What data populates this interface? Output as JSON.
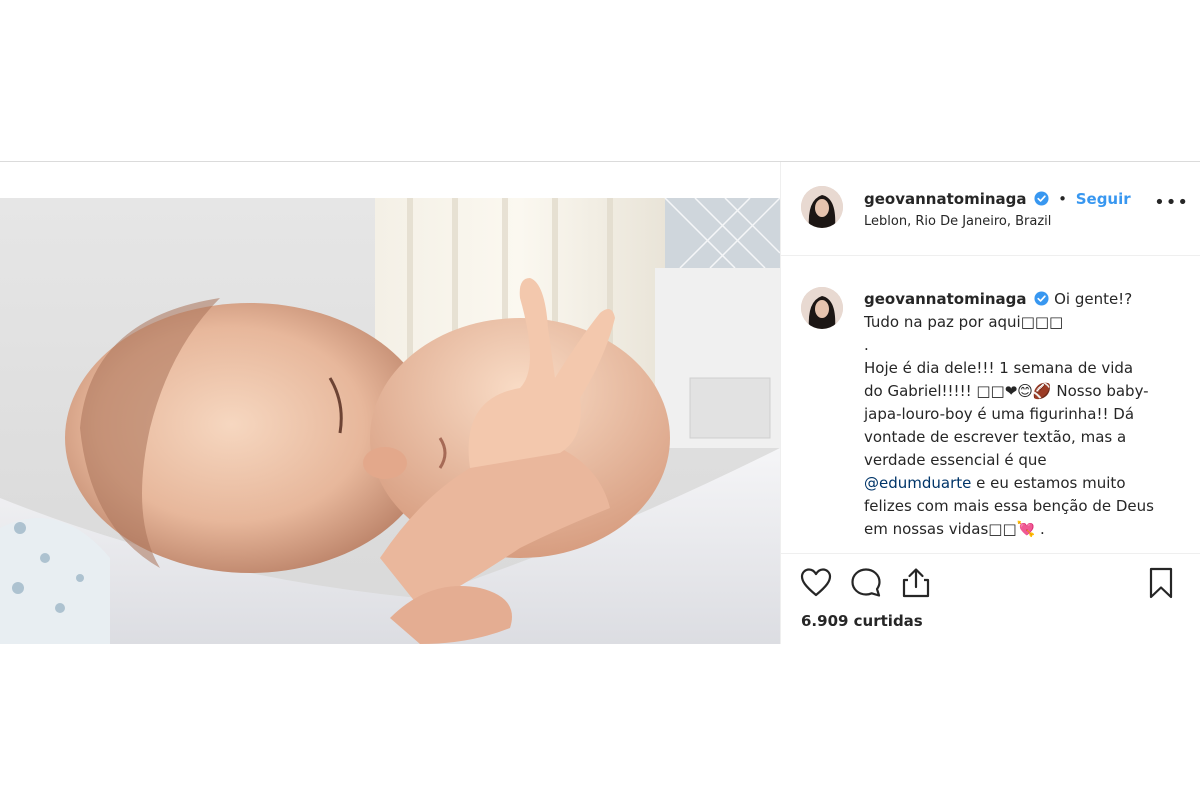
{
  "post": {
    "username": "geovannatominaga",
    "follow_label": "Seguir",
    "separator": "•",
    "location": "Leblon, Rio De Janeiro, Brazil",
    "more_label": "•••",
    "caption": {
      "username": "geovannatominaga",
      "lines": [
        "Oi gente!?",
        "Tudo na paz por aqui□□□",
        ".",
        "Hoje é dia dele!!! 1 semana de vida",
        "do Gabriel!!!!! □□❤😊🏈 Nosso baby-",
        "japa-louro-boy é uma figurinha!! Dá",
        "vontade de escrever textão, mas a",
        "verdade essencial é que",
        "e eu estamos muito",
        "felizes com mais essa benção de Deus",
        "em nossas vidas□□💘 ."
      ],
      "mention": "@edumduarte"
    },
    "likes": "6.909 curtidas"
  },
  "icons": {
    "like": "heart-icon",
    "comment": "comment-icon",
    "share": "share-icon",
    "save": "bookmark-icon",
    "verified": "verified-badge-icon",
    "more": "more-options-icon"
  },
  "colors": {
    "link_blue": "#3897f0",
    "verified_blue": "#3897f0",
    "text": "#262626",
    "mention": "#003569",
    "border": "#dbdbdb"
  }
}
